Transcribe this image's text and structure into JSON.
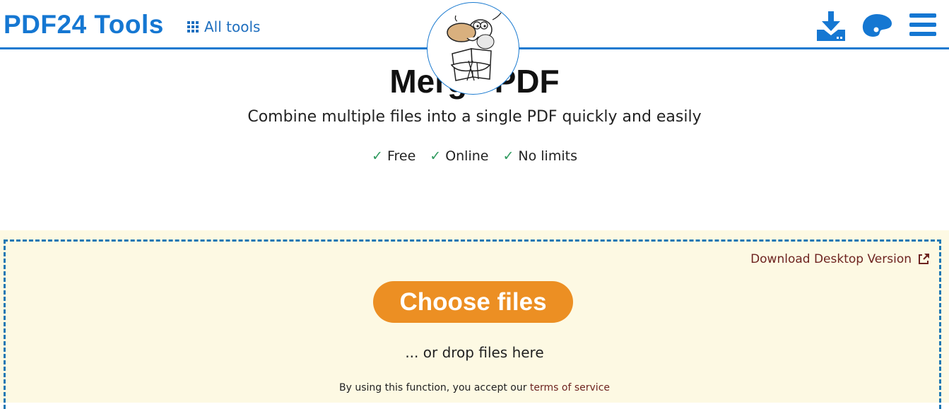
{
  "header": {
    "brand": "PDF24 Tools",
    "all_tools_label": "All tools",
    "icons": [
      "download-icon",
      "palette-icon",
      "menu-icon"
    ],
    "accent_color": "#1577d2"
  },
  "main": {
    "title": "Merge PDF",
    "subtitle": "Combine multiple files into a single PDF quickly and easily",
    "features": [
      {
        "check": "✓",
        "label": "Free"
      },
      {
        "check": "✓",
        "label": "Online"
      },
      {
        "check": "✓",
        "label": "No limits"
      }
    ]
  },
  "dropzone": {
    "desktop_link": "Download Desktop Version",
    "choose_button": "Choose files",
    "drop_text": "... or drop files here",
    "tos_prefix": "By using this function, you accept our",
    "tos_link": "terms of service",
    "button_color": "#ec8f23",
    "background_color": "#fdf9e3"
  }
}
